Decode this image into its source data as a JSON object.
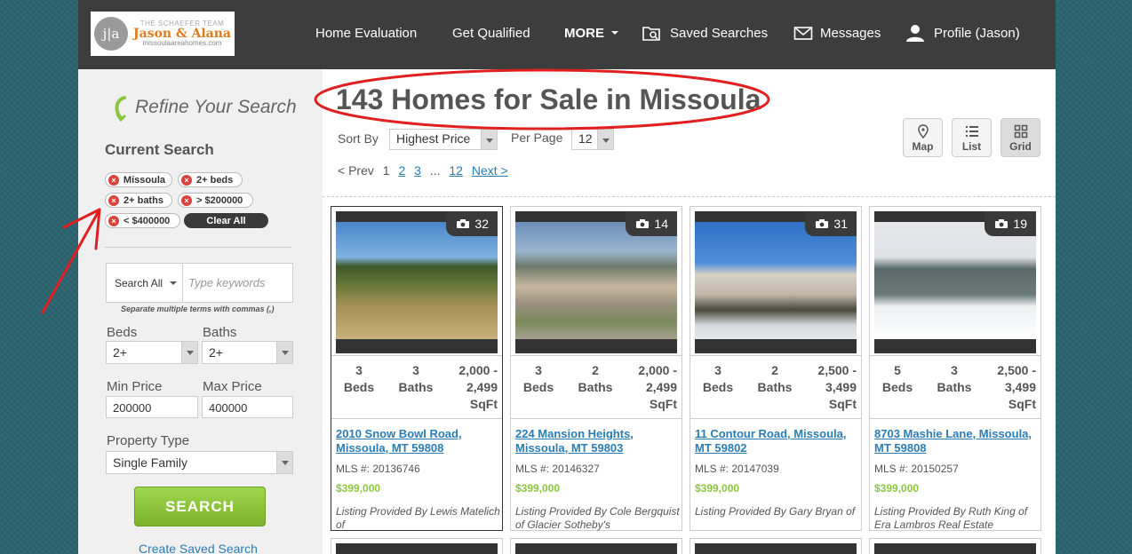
{
  "header": {
    "logo": {
      "initials": "j|a",
      "team": "THE SCHAEFER TEAM",
      "names": "Jason & Alana",
      "site": "missoulaareahomes.com"
    },
    "nav": {
      "home_evaluation": "Home Evaluation",
      "get_qualified": "Get Qualified",
      "more": "MORE",
      "saved_searches": "Saved Searches",
      "messages": "Messages",
      "profile": "Profile (Jason)"
    }
  },
  "sidebar": {
    "refine_title": "Refine Your Search",
    "current_search_title": "Current Search",
    "chips": [
      "Missoula",
      "2+ beds",
      "2+ baths",
      "> $200000",
      "< $400000"
    ],
    "clear_all": "Clear All",
    "search_scope": "Search All",
    "keywords_placeholder": "Type keywords",
    "separate_note": "Separate multiple terms with commas (,)",
    "beds_label": "Beds",
    "beds_value": "2+",
    "baths_label": "Baths",
    "baths_value": "2+",
    "min_price_label": "Min Price",
    "min_price_value": "200000",
    "max_price_label": "Max Price",
    "max_price_value": "400000",
    "property_type_label": "Property Type",
    "property_type_value": "Single Family",
    "search_button": "SEARCH",
    "create_saved_search": "Create Saved Search"
  },
  "main": {
    "title": "143 Homes for Sale in Missoula",
    "sort_by_label": "Sort By",
    "sort_by_value": "Highest Price",
    "per_page_label": "Per Page",
    "per_page_value": "12",
    "views": {
      "map": "Map",
      "list": "List",
      "grid": "Grid"
    },
    "active_view": "grid",
    "pager": {
      "prev": "< Prev",
      "current": "1",
      "pages": [
        "2",
        "3"
      ],
      "ellipsis": "...",
      "last": "12",
      "next": "Next >"
    }
  },
  "listings": [
    {
      "photos": "32",
      "beds": "3",
      "beds_label": "Beds",
      "baths": "3",
      "baths_label": "Baths",
      "sqft": "2,000 - 2,499",
      "sqft_label": "SqFt",
      "address": "2010 Snow Bowl Road, Missoula, MT 59808",
      "mls": "MLS #: 20136746",
      "price": "$399,000",
      "provided": "Listing Provided By Lewis Matelich of"
    },
    {
      "photos": "14",
      "beds": "3",
      "beds_label": "Beds",
      "baths": "2",
      "baths_label": "Baths",
      "sqft": "2,000 - 2,499",
      "sqft_label": "SqFt",
      "address": "224 Mansion Heights, Missoula, MT 59803",
      "mls": "MLS #: 20146327",
      "price": "$399,000",
      "provided": "Listing Provided By Cole Bergquist of Glacier Sotheby's"
    },
    {
      "photos": "31",
      "beds": "3",
      "beds_label": "Beds",
      "baths": "2",
      "baths_label": "Baths",
      "sqft": "2,500 - 3,499",
      "sqft_label": "SqFt",
      "address": "11 Contour Road, Missoula, MT 59802",
      "mls": "MLS #: 20147039",
      "price": "$399,000",
      "provided": "Listing Provided By Gary Bryan of"
    },
    {
      "photos": "19",
      "beds": "5",
      "beds_label": "Beds",
      "baths": "3",
      "baths_label": "Baths",
      "sqft": "2,500 - 3,499",
      "sqft_label": "SqFt",
      "address": "8703 Mashie Lane, Missoula, MT 59808",
      "mls": "MLS #: 20150257",
      "price": "$399,000",
      "provided": "Listing Provided By Ruth King of Era Lambros Real Estate"
    }
  ],
  "colors": {
    "header_bg": "#3d3d3d",
    "link": "#2a7db5",
    "price_green": "#8cc63f",
    "annotation_red": "#e02020",
    "background_teal": "#2b6470"
  }
}
